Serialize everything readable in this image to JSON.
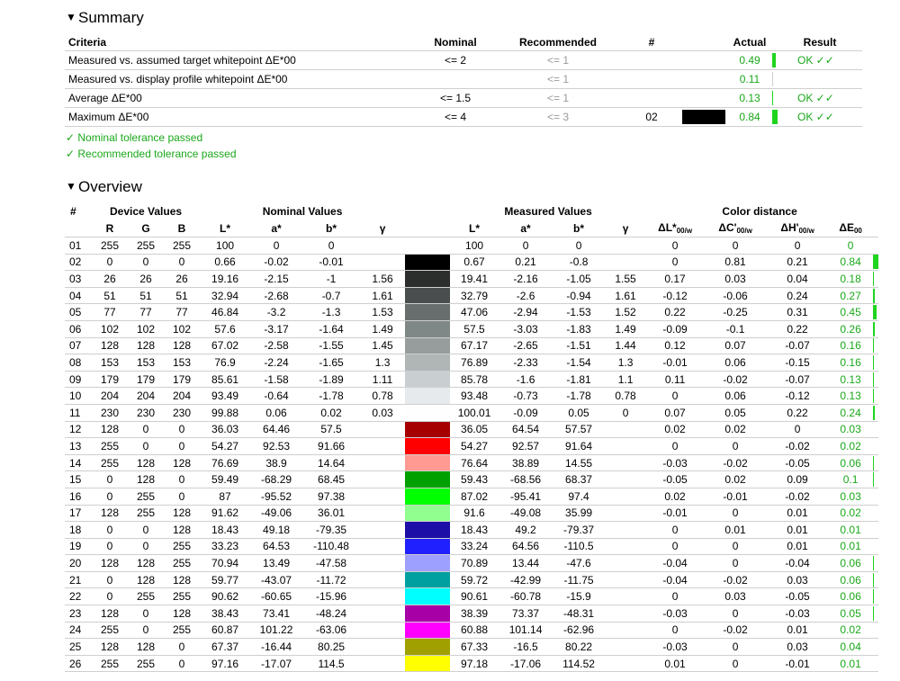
{
  "summary": {
    "title": "Summary",
    "headers": {
      "criteria": "Criteria",
      "nominal": "Nominal",
      "recommended": "Recommended",
      "num": "#",
      "actual": "Actual",
      "result": "Result"
    },
    "rows": [
      {
        "criteria": "Measured vs. assumed target whitepoint ΔE*00",
        "nominal": "<= 2",
        "recommended": "<= 1",
        "num": "",
        "swatch": "",
        "actual": "0.49",
        "bar": 0.049,
        "result": "OK ✓✓"
      },
      {
        "criteria": "Measured vs. display profile whitepoint ΔE*00",
        "nominal": "",
        "recommended": "<= 1",
        "num": "",
        "swatch": "",
        "actual": "0.11",
        "bar": 0.011,
        "result": ""
      },
      {
        "criteria": "Average ΔE*00",
        "nominal": "<= 1.5",
        "recommended": "<= 1",
        "num": "",
        "swatch": "",
        "actual": "0.13",
        "bar": 0.013,
        "result": "OK ✓✓"
      },
      {
        "criteria": "Maximum ΔE*00",
        "nominal": "<= 4",
        "recommended": "<= 3",
        "num": "02",
        "swatch": "#000000",
        "actual": "0.84",
        "bar": 0.084,
        "result": "OK ✓✓"
      }
    ],
    "passed": [
      "✓ Nominal tolerance passed",
      "✓ Recommended tolerance passed"
    ]
  },
  "overview": {
    "title": "Overview",
    "group_headers": {
      "num": "#",
      "device": "Device Values",
      "nominal": "Nominal Values",
      "measured": "Measured Values",
      "distance": "Color distance"
    },
    "col_headers": {
      "r": "R",
      "g": "G",
      "b": "B",
      "L": "L*",
      "a": "a*",
      "bstar": "b*",
      "gamma": "γ",
      "dL": "ΔL*",
      "dC": "ΔC'",
      "dH": "ΔH'",
      "dE": "ΔE",
      "sub_w": "00/w",
      "sub_00": "00"
    },
    "rows": [
      [
        "01",
        "255",
        "255",
        "255",
        "100",
        "0",
        "0",
        "",
        "#ffffff",
        "100",
        "0",
        "0",
        "",
        "0",
        "0",
        "0",
        "0"
      ],
      [
        "02",
        "0",
        "0",
        "0",
        "0.66",
        "-0.02",
        "-0.01",
        "",
        "#000000",
        "0.67",
        "0.21",
        "-0.8",
        "",
        "0",
        "0.81",
        "0.21",
        "0.84"
      ],
      [
        "03",
        "26",
        "26",
        "26",
        "19.16",
        "-2.15",
        "-1",
        "1.56",
        "#2c2e2e",
        "19.41",
        "-2.16",
        "-1.05",
        "1.55",
        "0.17",
        "0.03",
        "0.04",
        "0.18"
      ],
      [
        "04",
        "51",
        "51",
        "51",
        "32.94",
        "-2.68",
        "-0.7",
        "1.61",
        "#4a4e4e",
        "32.79",
        "-2.6",
        "-0.94",
        "1.61",
        "-0.12",
        "-0.06",
        "0.24",
        "0.27"
      ],
      [
        "05",
        "77",
        "77",
        "77",
        "46.84",
        "-3.2",
        "-1.3",
        "1.53",
        "#686e6e",
        "47.06",
        "-2.94",
        "-1.53",
        "1.52",
        "0.22",
        "-0.25",
        "0.31",
        "0.45"
      ],
      [
        "06",
        "102",
        "102",
        "102",
        "57.6",
        "-3.17",
        "-1.64",
        "1.49",
        "#808787",
        "57.5",
        "-3.03",
        "-1.83",
        "1.49",
        "-0.09",
        "-0.1",
        "0.22",
        "0.26"
      ],
      [
        "07",
        "128",
        "128",
        "128",
        "67.02",
        "-2.58",
        "-1.55",
        "1.45",
        "#979d9d",
        "67.17",
        "-2.65",
        "-1.51",
        "1.44",
        "0.12",
        "0.07",
        "-0.07",
        "0.16"
      ],
      [
        "08",
        "153",
        "153",
        "153",
        "76.9",
        "-2.24",
        "-1.65",
        "1.3",
        "#b0b6b6",
        "76.89",
        "-2.33",
        "-1.54",
        "1.3",
        "-0.01",
        "0.06",
        "-0.15",
        "0.16"
      ],
      [
        "09",
        "179",
        "179",
        "179",
        "85.61",
        "-1.58",
        "-1.89",
        "1.11",
        "#c9cfd0",
        "85.78",
        "-1.6",
        "-1.81",
        "1.1",
        "0.11",
        "-0.02",
        "-0.07",
        "0.13"
      ],
      [
        "10",
        "204",
        "204",
        "204",
        "93.49",
        "-0.64",
        "-1.78",
        "0.78",
        "#e6eaec",
        "93.48",
        "-0.73",
        "-1.78",
        "0.78",
        "0",
        "0.06",
        "-0.12",
        "0.13"
      ],
      [
        "11",
        "230",
        "230",
        "230",
        "99.88",
        "0.06",
        "0.02",
        "0.03",
        "#fefefe",
        "100.01",
        "-0.09",
        "0.05",
        "0",
        "0.07",
        "0.05",
        "0.22",
        "0.24"
      ],
      [
        "12",
        "128",
        "0",
        "0",
        "36.03",
        "64.46",
        "57.5",
        "",
        "#a60000",
        "36.05",
        "64.54",
        "57.57",
        "",
        "0.02",
        "0.02",
        "0",
        "0.03"
      ],
      [
        "13",
        "255",
        "0",
        "0",
        "54.27",
        "92.53",
        "91.66",
        "",
        "#ff0000",
        "54.27",
        "92.57",
        "91.64",
        "",
        "0",
        "0",
        "-0.02",
        "0.02"
      ],
      [
        "14",
        "255",
        "128",
        "128",
        "76.69",
        "38.9",
        "14.64",
        "",
        "#ff9a93",
        "76.64",
        "38.89",
        "14.55",
        "",
        "-0.03",
        "-0.02",
        "-0.05",
        "0.06"
      ],
      [
        "15",
        "0",
        "128",
        "0",
        "59.49",
        "-68.29",
        "68.45",
        "",
        "#00a000",
        "59.43",
        "-68.56",
        "68.37",
        "",
        "-0.05",
        "0.02",
        "0.09",
        "0.1"
      ],
      [
        "16",
        "0",
        "255",
        "0",
        "87",
        "-95.52",
        "97.38",
        "",
        "#00ff00",
        "87.02",
        "-95.41",
        "97.4",
        "",
        "0.02",
        "-0.01",
        "-0.02",
        "0.03"
      ],
      [
        "17",
        "128",
        "255",
        "128",
        "91.62",
        "-49.06",
        "36.01",
        "",
        "#90ff90",
        "91.6",
        "-49.08",
        "35.99",
        "",
        "-0.01",
        "0",
        "0.01",
        "0.02"
      ],
      [
        "18",
        "0",
        "0",
        "128",
        "18.43",
        "49.18",
        "-79.35",
        "",
        "#1c0ea6",
        "18.43",
        "49.2",
        "-79.37",
        "",
        "0",
        "0.01",
        "0.01",
        "0.01"
      ],
      [
        "19",
        "0",
        "0",
        "255",
        "33.23",
        "64.53",
        "-110.48",
        "",
        "#2020ff",
        "33.24",
        "64.56",
        "-110.5",
        "",
        "0",
        "0",
        "0.01",
        "0.01"
      ],
      [
        "20",
        "128",
        "128",
        "255",
        "70.94",
        "13.49",
        "-47.58",
        "",
        "#9ea0ff",
        "70.89",
        "13.44",
        "-47.6",
        "",
        "-0.04",
        "0",
        "-0.04",
        "0.06"
      ],
      [
        "21",
        "0",
        "128",
        "128",
        "59.77",
        "-43.07",
        "-11.72",
        "",
        "#00a0a0",
        "59.72",
        "-42.99",
        "-11.75",
        "",
        "-0.04",
        "-0.02",
        "0.03",
        "0.06"
      ],
      [
        "22",
        "0",
        "255",
        "255",
        "90.62",
        "-60.65",
        "-15.96",
        "",
        "#00ffff",
        "90.61",
        "-60.78",
        "-15.9",
        "",
        "0",
        "0.03",
        "-0.05",
        "0.06"
      ],
      [
        "23",
        "128",
        "0",
        "128",
        "38.43",
        "73.41",
        "-48.24",
        "",
        "#a600a6",
        "38.39",
        "73.37",
        "-48.31",
        "",
        "-0.03",
        "0",
        "-0.03",
        "0.05"
      ],
      [
        "24",
        "255",
        "0",
        "255",
        "60.87",
        "101.22",
        "-63.06",
        "",
        "#ff00ff",
        "60.88",
        "101.14",
        "-62.96",
        "",
        "0",
        "-0.02",
        "0.01",
        "0.02"
      ],
      [
        "25",
        "128",
        "128",
        "0",
        "67.37",
        "-16.44",
        "80.25",
        "",
        "#a0a000",
        "67.33",
        "-16.5",
        "80.22",
        "",
        "-0.03",
        "0",
        "0.03",
        "0.04"
      ],
      [
        "26",
        "255",
        "255",
        "0",
        "97.16",
        "-17.07",
        "114.5",
        "",
        "#ffff00",
        "97.18",
        "-17.06",
        "114.52",
        "",
        "0.01",
        "0",
        "-0.01",
        "0.01"
      ]
    ]
  }
}
